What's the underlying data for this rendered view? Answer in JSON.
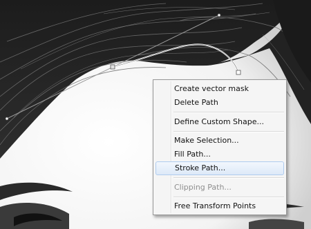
{
  "canvas": {
    "description_icon": "hair-photo"
  },
  "context_menu": {
    "items": [
      {
        "label": "Create vector mask",
        "enabled": true
      },
      {
        "label": "Delete Path",
        "enabled": true
      },
      {
        "label": "Define Custom Shape...",
        "enabled": true
      },
      {
        "label": "Make Selection...",
        "enabled": true
      },
      {
        "label": "Fill Path...",
        "enabled": true
      },
      {
        "label": "Stroke Path...",
        "enabled": true,
        "highlighted": true
      },
      {
        "label": "Clipping Path...",
        "enabled": false
      },
      {
        "label": "Free Transform Points",
        "enabled": true
      }
    ]
  },
  "colors": {
    "menu_background": "#f5f5f5",
    "menu_border": "#979797",
    "highlight_border": "#aecbee",
    "disabled_text": "#8e8e8e"
  }
}
